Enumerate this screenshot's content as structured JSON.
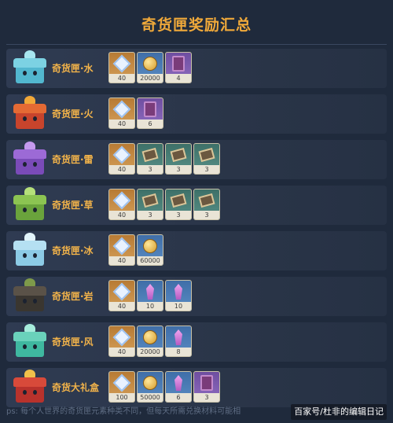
{
  "title": "奇货匣奖励汇总",
  "rows": [
    {
      "name": "奇货匣·水",
      "chest": {
        "body": "#52b7cf",
        "lid": "#7cd2e3",
        "top": "#a7e6f0"
      },
      "items": [
        {
          "icon": "primogem-icon",
          "bg": "gold",
          "count": "40"
        },
        {
          "icon": "mora-coin-icon",
          "bg": "blue",
          "count": "20000"
        },
        {
          "icon": "talent-book-icon",
          "bg": "purple",
          "count": "4"
        }
      ]
    },
    {
      "name": "奇货匣·火",
      "chest": {
        "body": "#c8442c",
        "lid": "#e46a34",
        "top": "#f1a838"
      },
      "items": [
        {
          "icon": "primogem-icon",
          "bg": "gold",
          "count": "40"
        },
        {
          "icon": "talent-book-icon",
          "bg": "purple",
          "count": "6"
        }
      ]
    },
    {
      "name": "奇货匣·雷",
      "chest": {
        "body": "#7a4bb8",
        "lid": "#9c6ad6",
        "top": "#c59af0"
      },
      "items": [
        {
          "icon": "primogem-icon",
          "bg": "gold",
          "count": "40"
        },
        {
          "icon": "card-icon",
          "bg": "green",
          "count": "3"
        },
        {
          "icon": "card-icon",
          "bg": "green",
          "count": "3"
        },
        {
          "icon": "card-icon",
          "bg": "green",
          "count": "3"
        }
      ]
    },
    {
      "name": "奇货匣·草",
      "chest": {
        "body": "#6aa33c",
        "lid": "#8cc452",
        "top": "#b5e07a"
      },
      "items": [
        {
          "icon": "primogem-icon",
          "bg": "gold",
          "count": "40"
        },
        {
          "icon": "card-icon",
          "bg": "green",
          "count": "3"
        },
        {
          "icon": "card-icon",
          "bg": "green",
          "count": "3"
        },
        {
          "icon": "card-icon",
          "bg": "green",
          "count": "3"
        }
      ]
    },
    {
      "name": "奇货匣·冰",
      "chest": {
        "body": "#8ccbe6",
        "lid": "#b5e0f2",
        "top": "#e2f4fb"
      },
      "items": [
        {
          "icon": "primogem-icon",
          "bg": "gold",
          "count": "40"
        },
        {
          "icon": "mora-coin-icon",
          "bg": "blue",
          "count": "60000"
        }
      ]
    },
    {
      "name": "奇货匣·岩",
      "chest": {
        "body": "#3a3630",
        "lid": "#5a5248",
        "top": "#7e9a4a"
      },
      "items": [
        {
          "icon": "primogem-icon",
          "bg": "gold",
          "count": "40"
        },
        {
          "icon": "crystal-icon",
          "bg": "blue",
          "count": "10"
        },
        {
          "icon": "crystal-icon",
          "bg": "blue",
          "count": "10"
        }
      ]
    },
    {
      "name": "奇货匣·风",
      "chest": {
        "body": "#3fb8a0",
        "lid": "#6ad2bb",
        "top": "#a6ecdc"
      },
      "items": [
        {
          "icon": "primogem-icon",
          "bg": "gold",
          "count": "40"
        },
        {
          "icon": "mora-coin-icon",
          "bg": "blue",
          "count": "20000"
        },
        {
          "icon": "crystal-icon",
          "bg": "blue",
          "count": "8"
        }
      ]
    },
    {
      "name": "奇货大礼盒",
      "chest": {
        "body": "#b8322c",
        "lid": "#d84a3a",
        "top": "#f0c04a"
      },
      "items": [
        {
          "icon": "primogem-icon",
          "bg": "gold",
          "count": "100"
        },
        {
          "icon": "mora-coin-icon",
          "bg": "blue",
          "count": "50000"
        },
        {
          "icon": "crystal-icon",
          "bg": "blue",
          "count": "6"
        },
        {
          "icon": "talent-book-icon",
          "bg": "purple",
          "count": "3"
        }
      ]
    }
  ],
  "footer": "ps: 每个人世界的奇货匣元素种类不同，但每天所需兑换材料可能相",
  "watermark": "百家号/杜非的编辑日记"
}
